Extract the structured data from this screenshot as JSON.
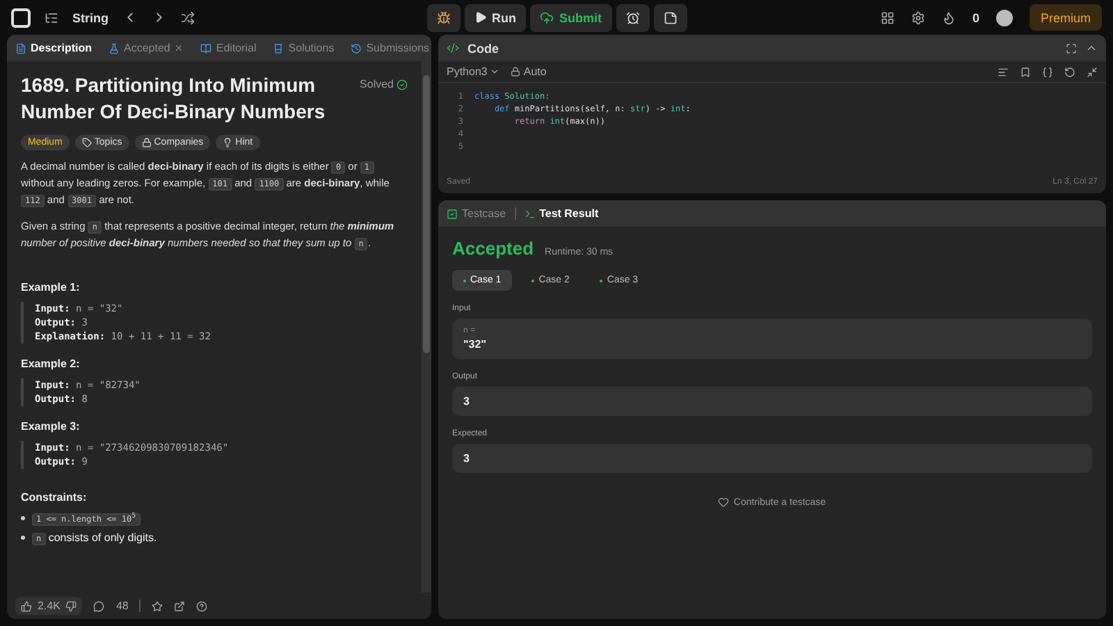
{
  "topbar": {
    "list_title": "String",
    "run": "Run",
    "submit": "Submit",
    "streak": "0",
    "premium": "Premium"
  },
  "left_tabs": [
    {
      "label": "Description",
      "selected": true,
      "closable": false
    },
    {
      "label": "Accepted",
      "selected": false,
      "closable": true
    },
    {
      "label": "Editorial",
      "selected": false,
      "closable": false
    },
    {
      "label": "Solutions",
      "selected": false,
      "closable": false
    },
    {
      "label": "Submissions",
      "selected": false,
      "closable": false
    }
  ],
  "problem": {
    "title": "1689. Partitioning Into Minimum Number Of Deci-Binary Numbers",
    "status": "Solved",
    "difficulty": "Medium",
    "tags": [
      "Topics",
      "Companies",
      "Hint"
    ],
    "paragraphs": [
      [
        {
          "kind": "text",
          "text": "A decimal number is called **deci-binary** if each of its digits is either "
        },
        {
          "kind": "code",
          "text": "0"
        },
        {
          "kind": "text",
          "text": " or "
        },
        {
          "kind": "code",
          "text": "1"
        },
        {
          "kind": "text",
          "text": " without any leading zeros. For example, "
        },
        {
          "kind": "code",
          "text": "101"
        },
        {
          "kind": "text",
          "text": " and "
        },
        {
          "kind": "code",
          "text": "1100"
        },
        {
          "kind": "text",
          "text": " are **deci-binary**, while "
        },
        {
          "kind": "code",
          "text": "112"
        },
        {
          "kind": "text",
          "text": " and "
        },
        {
          "kind": "code",
          "text": "3001"
        },
        {
          "kind": "text",
          "text": " are not."
        }
      ],
      [
        {
          "kind": "text",
          "text": "Given a string "
        },
        {
          "kind": "code",
          "text": "n"
        },
        {
          "kind": "text",
          "text": " that represents a positive decimal integer, return "
        },
        {
          "kind": "italic",
          "text": "the **minimum** number of positive **deci-binary** numbers needed so that they sum up to "
        },
        {
          "kind": "code",
          "text": "n"
        },
        {
          "kind": "text",
          "text": "."
        }
      ]
    ],
    "examples": [
      {
        "title": "Example 1:",
        "lines": [
          {
            "label": "Input:",
            "value": "n = \"32\""
          },
          {
            "label": "Output:",
            "value": "3"
          },
          {
            "label": "Explanation:",
            "value": "10 + 11 + 11 = 32"
          }
        ]
      },
      {
        "title": "Example 2:",
        "lines": [
          {
            "label": "Input:",
            "value": "n = \"82734\""
          },
          {
            "label": "Output:",
            "value": "8"
          }
        ]
      },
      {
        "title": "Example 3:",
        "lines": [
          {
            "label": "Input:",
            "value": "n = \"27346209830709182346\""
          },
          {
            "label": "Output:",
            "value": "9"
          }
        ]
      }
    ],
    "constraints_title": "Constraints:",
    "constraints": [
      [
        {
          "kind": "code",
          "text": "1 <= n.length <= 10$^{5}$"
        }
      ],
      [
        {
          "kind": "code",
          "text": "n"
        },
        {
          "kind": "text",
          "text": " consists of only digits."
        }
      ]
    ]
  },
  "footer": {
    "likes": "2.4K",
    "comments": "48"
  },
  "code": {
    "title": "Code",
    "language": "Python3",
    "mode": "Auto",
    "saved": "Saved",
    "cursor": "Ln 3, Col 27",
    "lines": [
      {
        "number": "1",
        "tokens": [
          {
            "kind": "keyword",
            "text": "class"
          },
          {
            "kind": "type",
            "text": " Solution:"
          }
        ]
      },
      {
        "number": "2",
        "tokens": [
          {
            "kind": "keyword",
            "text": "    def"
          },
          {
            "kind": "plain",
            "text": " minPartitions(self, n: "
          },
          {
            "kind": "type",
            "text": "str"
          },
          {
            "kind": "plain",
            "text": ") -> "
          },
          {
            "kind": "type",
            "text": "int"
          },
          {
            "kind": "plain",
            "text": ":"
          }
        ]
      },
      {
        "number": "3",
        "tokens": [
          {
            "kind": "control",
            "text": "        return"
          },
          {
            "kind": "type",
            "text": " int"
          },
          {
            "kind": "plain",
            "text": "(max(n))"
          }
        ]
      },
      {
        "number": "4"
      },
      {
        "number": "5"
      }
    ]
  },
  "result": {
    "tabs": [
      {
        "label": "Testcase",
        "selected": false
      },
      {
        "label": "Test Result",
        "selected": true
      }
    ],
    "verdict": "Accepted",
    "runtime": "Runtime: 30 ms",
    "cases": [
      {
        "label": "Case 1",
        "selected": true
      },
      {
        "label": "Case 2",
        "selected": false
      },
      {
        "label": "Case 3",
        "selected": false
      }
    ],
    "input_label": "Input",
    "input_var": "n =",
    "input_value": "\"32\"",
    "output_label": "Output",
    "output_value": "3",
    "expected_label": "Expected",
    "expected_value": "3",
    "contribute": "Contribute a testcase"
  }
}
